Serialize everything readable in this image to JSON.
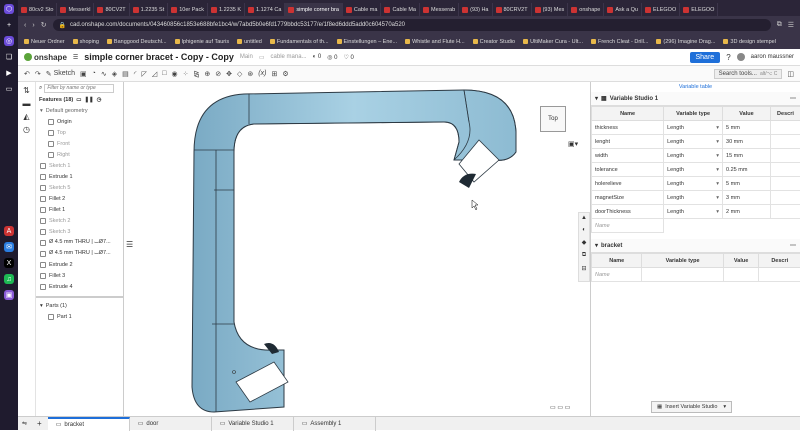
{
  "browser": {
    "tabs": [
      "80cv2 Sto",
      "Messerkl",
      "80CV2T",
      "1.2235 St",
      "10er Pack",
      "1.2235 K",
      "1.1274 Ca",
      "simple corner bra",
      "Cable ma",
      "Cable Ma",
      "Messerab",
      "(93) Ha",
      "80CRV2T",
      "(93) Mes",
      "onshape",
      "Ask a Qu",
      "ELEGOO",
      "ELEGOO"
    ],
    "active_tab": 7,
    "url": "cad.onshape.com/documents/043460856c1853e688bfe1bc4/w/7abd5b0e6fd1779bbdc53177/e/1f8ed6ddd5add0c604570a520",
    "bookmarks": [
      "Neuer Ordner",
      "shoping",
      "Banggood Deutschl...",
      "Iphigenie auf Tauris",
      "untitled",
      "Fundamentals of th...",
      "Einstellungen – Ene...",
      "Whistle and Flute H...",
      "Creator Studio",
      "UltiMaker Cura - Ult...",
      "French Cleat - Drill...",
      "(296) Imagine Drag...",
      "3D design stempel"
    ]
  },
  "app": {
    "logo": "onshape",
    "doc_title": "simple corner bracet - Copy - Copy",
    "branch": "Main",
    "breadcrumb": "cable mana...",
    "counts": [
      "0",
      "0",
      "0"
    ],
    "share": "Share",
    "help": "?",
    "user": "aaron maussner"
  },
  "toolbar": {
    "sketch": "Sketch",
    "search": "Search tools...",
    "shortcut": "alt/⌥ C",
    "variable_table_link": "Variable table"
  },
  "features": {
    "filter_placeholder": "Filter by name or type",
    "header": "Features (18)",
    "default_geometry": "Default geometry",
    "items": [
      {
        "label": "Origin",
        "dim": false
      },
      {
        "label": "Top",
        "dim": true
      },
      {
        "label": "Front",
        "dim": true
      },
      {
        "label": "Right",
        "dim": true
      },
      {
        "label": "Sketch 1",
        "dim": true
      },
      {
        "label": "Extrude 1",
        "dim": false
      },
      {
        "label": "Sketch 5",
        "dim": true
      },
      {
        "label": "Fillet 2",
        "dim": false
      },
      {
        "label": "Fillet 1",
        "dim": false
      },
      {
        "label": "Sketch 2",
        "dim": true
      },
      {
        "label": "Sketch 3",
        "dim": true
      },
      {
        "label": "Ø 4.5 mm THRU | ⌴Ø7...",
        "dim": false
      },
      {
        "label": "Ø 4.5 mm THRU | ⌴Ø7...",
        "dim": false
      },
      {
        "label": "Extrude 2",
        "dim": false
      },
      {
        "label": "Fillet 3",
        "dim": false
      },
      {
        "label": "Extrude 4",
        "dim": false
      }
    ],
    "parts_header": "Parts (1)",
    "parts": [
      "Part 1"
    ]
  },
  "viewcube": {
    "label": "Top"
  },
  "variable_studio": {
    "title": "Variable Studio 1",
    "columns": [
      "Name",
      "Variable type",
      "Value",
      "Descri"
    ],
    "rows": [
      [
        "thickness",
        "Length",
        "5 mm",
        ""
      ],
      [
        "lenght",
        "Length",
        "30 mm",
        ""
      ],
      [
        "width",
        "Length",
        "15 mm",
        ""
      ],
      [
        "tolerance",
        "Length",
        "0.25 mm",
        ""
      ],
      [
        "holerelieve",
        "Length",
        "5 mm",
        ""
      ],
      [
        "magnetSize",
        "Length",
        "3 mm",
        ""
      ],
      [
        "doorThickness",
        "Length",
        "2 mm",
        ""
      ]
    ],
    "name_placeholder": "Name",
    "section2_title": "bracket",
    "section2_columns": [
      "Name",
      "Variable type",
      "Value",
      "Descri"
    ],
    "insert_button": "Insert Variable Studio"
  },
  "bottom_tabs": [
    "bracket",
    "door",
    "Variable Studio 1",
    "Assembly 1"
  ],
  "colors": {
    "accent": "#1e6fd9",
    "part": "#9ccbe0",
    "part_edge": "#333333"
  }
}
